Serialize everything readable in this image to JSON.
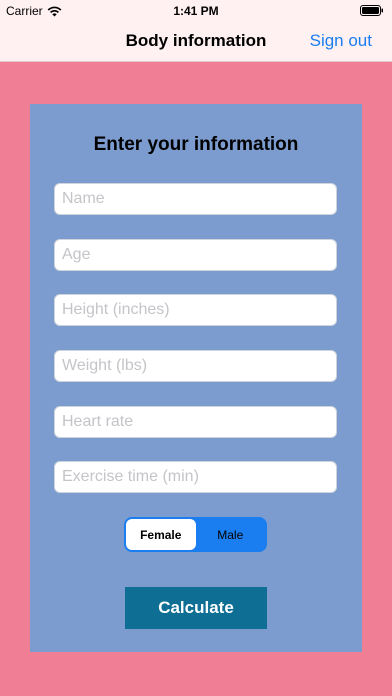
{
  "status_bar": {
    "carrier": "Carrier",
    "time": "1:41 PM"
  },
  "nav": {
    "title": "Body information",
    "sign_out": "Sign out"
  },
  "form": {
    "title": "Enter your information",
    "fields": [
      {
        "placeholder": "Name",
        "value": ""
      },
      {
        "placeholder": "Age",
        "value": ""
      },
      {
        "placeholder": "Height (inches)",
        "value": ""
      },
      {
        "placeholder": "Weight (lbs)",
        "value": ""
      },
      {
        "placeholder": "Heart rate",
        "value": ""
      },
      {
        "placeholder": "Exercise time (min)",
        "value": ""
      }
    ],
    "gender": {
      "options": [
        "Female",
        "Male"
      ],
      "selected": "Female"
    },
    "calculate_label": "Calculate"
  },
  "colors": {
    "background": "#f07f95",
    "card": "#7c9cd0",
    "accent": "#1a7ef0",
    "button": "#0e6e94"
  },
  "icons": [
    "wifi-icon",
    "battery-icon"
  ]
}
